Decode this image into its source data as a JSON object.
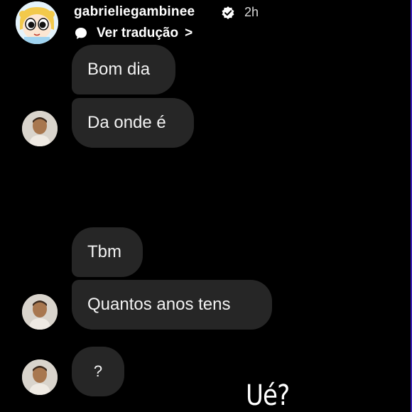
{
  "story": {
    "username": "gabrieliegambinee",
    "time": "2h",
    "translate_label": "Ver tradução",
    "translate_chevron": ">",
    "avatar_icon": "powerpuff-avatar-icon",
    "verified_icon": "verified-badge-icon",
    "translate_icon": "speech-bubble-icon"
  },
  "messages": [
    {
      "text": "Bom dia"
    },
    {
      "text": "Da onde é"
    },
    {
      "text": "Tbm"
    },
    {
      "text": "Quantos anos tens"
    },
    {
      "text": "?"
    }
  ],
  "overlay_text": "Ué?",
  "colors": {
    "background": "#000000",
    "bubble": "#262626",
    "text": "#f2f2f2",
    "edge_accent": "#3a1fb8"
  }
}
